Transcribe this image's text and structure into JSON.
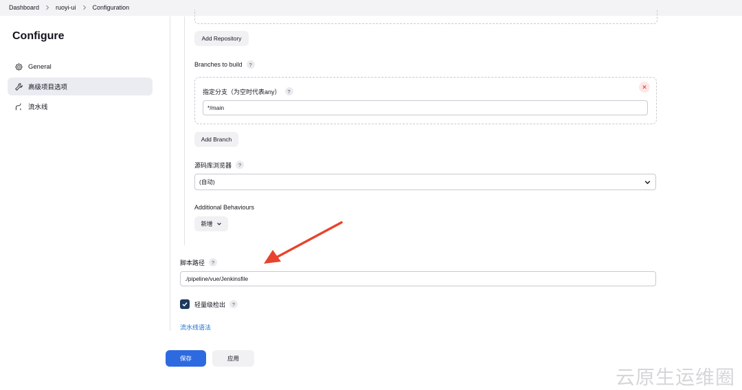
{
  "breadcrumb": {
    "items": [
      "Dashboard",
      "ruoyi-ui",
      "Configuration"
    ]
  },
  "sidebar": {
    "title": "Configure",
    "items": [
      {
        "label": "General",
        "icon": "gear-icon"
      },
      {
        "label": "高级项目选项",
        "icon": "wrench-icon",
        "active": true
      },
      {
        "label": "流水线",
        "icon": "pipeline-icon"
      }
    ]
  },
  "scm": {
    "add_repository_label": "Add Repository",
    "branches_label": "Branches to build",
    "branch_specifier_label": "指定分支（为空时代表any）",
    "branch_specifier_value": "*/main",
    "add_branch_label": "Add Branch",
    "repo_browser_label": "源码库浏览器",
    "repo_browser_value": "(自动)",
    "additional_behaviours_label": "Additional Behaviours",
    "add_behaviour_label": "新增"
  },
  "pipeline": {
    "script_path_label": "脚本路径",
    "script_path_value": "./pipeline/vue/Jenkinsfile",
    "lightweight_checkout_label": "轻量级检出",
    "lightweight_checkout_checked": true,
    "syntax_link_label": "流水线语法"
  },
  "help_glyph": "?",
  "footer": {
    "save_label": "保存",
    "apply_label": "应用"
  },
  "watermark": "云原生运维圈",
  "colors": {
    "accent": "#2d6ae0",
    "arrow": "#e8432b",
    "link": "#1f6fd1"
  }
}
